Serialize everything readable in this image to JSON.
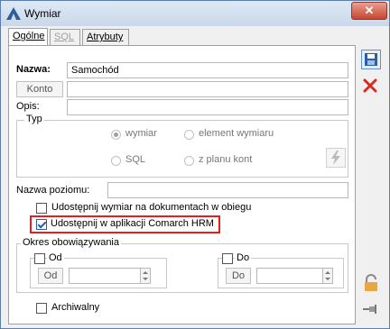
{
  "window": {
    "title": "Wymiar",
    "close_glyph": "✕"
  },
  "tabs": [
    {
      "label": "Ogólne",
      "active": true,
      "enabled": true
    },
    {
      "label": "SQL",
      "active": false,
      "enabled": false
    },
    {
      "label": "Atrybuty",
      "active": false,
      "enabled": true
    }
  ],
  "form": {
    "nazwa_label": "Nazwa:",
    "nazwa_value": "Samochód",
    "konto_button": "Konto",
    "konto_value": "",
    "opis_label": "Opis:",
    "opis_value": "",
    "typ_group": "Typ",
    "typ_options": [
      {
        "label": "wymiar",
        "checked": true
      },
      {
        "label": "element wymiaru",
        "checked": false
      },
      {
        "label": "SQL",
        "checked": false
      },
      {
        "label": "z planu kont",
        "checked": false
      }
    ],
    "nazwa_poziomu_label": "Nazwa poziomu:",
    "nazwa_poziomu_value": "",
    "udostepnij_obieg_label": "Udostępnij wymiar na dokumentach w obiegu",
    "udostepnij_obieg_checked": false,
    "udostepnij_hrm_label": "Udostępnij w aplikacji Comarch HRM",
    "udostepnij_hrm_checked": true,
    "highlight_color": "#e02020",
    "okres_group": "Okres obowiązywania",
    "od_label": "Od",
    "od_button": "Od",
    "od_value": "",
    "do_label": "Do",
    "do_button": "Do",
    "do_value": "",
    "archiwalny_label": "Archiwalny",
    "archiwalny_checked": false
  },
  "side": {
    "save_icon": "floppy-save-icon",
    "delete_icon": "red-x-delete-icon",
    "lock_icon": "padlock-icon",
    "pin_icon": "pin-icon"
  }
}
